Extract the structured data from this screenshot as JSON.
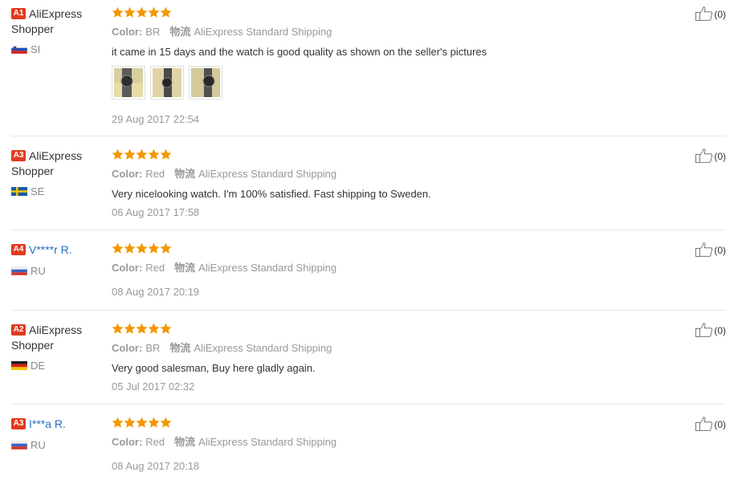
{
  "reviews": [
    {
      "level": "A1",
      "name_line1": "AliExpress",
      "name_line2": "Shopper",
      "country": "SI",
      "stars": 5,
      "color_label": "Color:",
      "color_value": "BR",
      "logistics_label": "物流",
      "logistics_value": "AliExpress Standard Shipping",
      "text": "it came in 15 days and the watch is good quality as shown on the seller's pictures",
      "photo_count": 3,
      "date": "29 Aug 2017 22:54",
      "helpful": "(0)"
    },
    {
      "level": "A3",
      "name_line1": "AliExpress",
      "name_line2": "Shopper",
      "country": "SE",
      "stars": 5,
      "color_label": "Color:",
      "color_value": "Red",
      "logistics_label": "物流",
      "logistics_value": "AliExpress Standard Shipping",
      "text": "Very nicelooking watch. I'm 100% satisfied. Fast shipping to Sweden.",
      "date": "06 Aug 2017 17:58",
      "helpful": "(0)"
    },
    {
      "level": "A4",
      "name_line1": "V****r R.",
      "name_line2": "",
      "country": "RU",
      "stars": 5,
      "color_label": "Color:",
      "color_value": "Red",
      "logistics_label": "物流",
      "logistics_value": "AliExpress Standard Shipping",
      "text": "",
      "date": "08 Aug 2017 20:19",
      "helpful": "(0)"
    },
    {
      "level": "A2",
      "name_line1": "AliExpress",
      "name_line2": "Shopper",
      "country": "DE",
      "stars": 5,
      "color_label": "Color:",
      "color_value": "BR",
      "logistics_label": "物流",
      "logistics_value": "AliExpress Standard Shipping",
      "text": "Very good salesman, Buy here gladly again.",
      "date": "05 Jul 2017 02:32",
      "helpful": "(0)"
    },
    {
      "level": "A3",
      "name_line1": "I***a R.",
      "name_line2": "",
      "country": "RU",
      "stars": 5,
      "color_label": "Color:",
      "color_value": "Red",
      "logistics_label": "物流",
      "logistics_value": "AliExpress Standard Shipping",
      "text": "",
      "date": "08 Aug 2017 20:18",
      "helpful": "(0)"
    }
  ],
  "colors": {
    "star": "#f39800",
    "badge": "#e23a1f",
    "masked_name": "#2a6fc0",
    "muted": "#999999"
  },
  "icons": {
    "star": "star-icon",
    "helpful": "thumbs-up-icon",
    "photo": "review-photo-thumbnail"
  }
}
